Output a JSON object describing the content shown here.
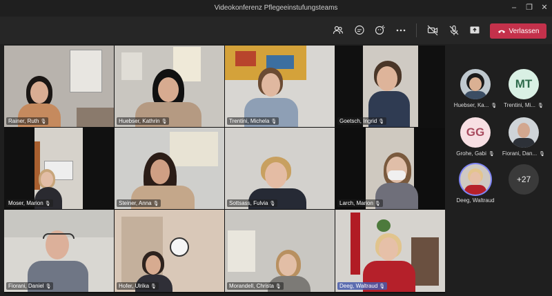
{
  "window": {
    "title": "Videokonferenz Pflegeeinstufungsteams",
    "minimize": "–",
    "maximize": "❐",
    "close": "✕"
  },
  "toolbar": {
    "leave_label": "Verlassen"
  },
  "tiles": [
    {
      "name": "Rainer, Ruth"
    },
    {
      "name": "Huebser, Kathrin"
    },
    {
      "name": "Trentini, Michela"
    },
    {
      "name": "Goetsch, Ingrid"
    },
    {
      "name": "Moser, Marion"
    },
    {
      "name": "Steiner, Anna"
    },
    {
      "name": "Sottsass, Fulvia"
    },
    {
      "name": "Larch, Marion"
    },
    {
      "name": "Fiorani, Daniel"
    },
    {
      "name": "Hofer, Ulrika"
    },
    {
      "name": "Morandell, Christa"
    },
    {
      "name": "Deeg, Waltraud"
    }
  ],
  "attendees": [
    {
      "name": "Huebser, Ka...",
      "initials": ""
    },
    {
      "name": "Trentini, Mi...",
      "initials": "MT"
    },
    {
      "name": "Grohe, Gabi",
      "initials": "GG"
    },
    {
      "name": "Fiorani, Dan...",
      "initials": ""
    },
    {
      "name": "Deeg, Waltraud",
      "initials": ""
    }
  ],
  "more_count": "+27",
  "colors": {
    "leave": "#c4314b",
    "background": "#1f1f1f",
    "toolbar": "#262626"
  }
}
